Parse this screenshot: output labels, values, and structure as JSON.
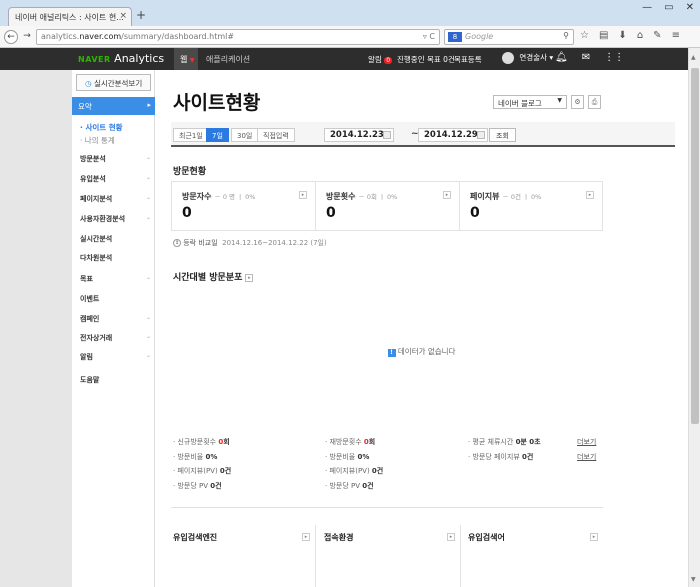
{
  "browser": {
    "tab_title": "네이버 애널리틱스 : 사이트 현...",
    "tab_close": "×",
    "new_tab": "+",
    "url_prefix": "analytics.",
    "url_domain": "naver.com",
    "url_path": "/summary/dashboard.html#",
    "search_engine": "8",
    "search_placeholder": "Google"
  },
  "topbar": {
    "logo_naver": "NAVER",
    "logo_analytics": "Analytics",
    "menu_web": "웹",
    "menu_app": "애플리케이션",
    "alarm_label": "알림",
    "alarm_count": "0",
    "progress_goal": "진행중인 목표 0건",
    "goal_register": "목표등록",
    "user_name": "연경술사 ▾"
  },
  "sidebar": {
    "realtime_button": "실시간분석보기",
    "active_item": "요약",
    "sub_items": [
      "· 사이트 현황",
      "· 나의 통계"
    ],
    "items": [
      {
        "label": "방문분석",
        "chev": true
      },
      {
        "label": "유입분석",
        "chev": true
      },
      {
        "label": "페이지분석",
        "chev": true
      },
      {
        "label": "사용자환경분석",
        "chev": true
      },
      {
        "label": "실시간분석",
        "chev": false
      },
      {
        "label": "다차원분석",
        "chev": false
      },
      {
        "label": "목표",
        "chev": true
      },
      {
        "label": "이벤트",
        "chev": false
      },
      {
        "label": "캠페인",
        "chev": true
      },
      {
        "label": "전자상거래",
        "chev": true
      },
      {
        "label": "알림",
        "chev": true
      },
      {
        "label": "도움말",
        "chev": false
      }
    ]
  },
  "main": {
    "page_title": "사이트현황",
    "site_select": "네이버 블로그",
    "range_buttons": [
      "최근1일",
      "7일",
      "30일",
      "직접입력"
    ],
    "selected_range": "7일",
    "date_start": "2014.12.23",
    "date_tilde": "~",
    "date_end": "2014.12.29",
    "search_button": "조회",
    "visit_section_title": "방문현황",
    "stats": [
      {
        "label": "방문자수",
        "sub": "－ 0 명 ㅣ 0%",
        "value": "0"
      },
      {
        "label": "방문횟수",
        "sub": "－ 0회 ㅣ 0%",
        "value": "0"
      },
      {
        "label": "페이지뷰",
        "sub": "－ 0건 ㅣ 0%",
        "value": "0"
      }
    ],
    "compare_label": "등락 비교일",
    "compare_range": "2014.12.16~2014.12.22 (7일)",
    "time_section_title": "시간대별 방문분포",
    "no_data": "데이터가 없습니다",
    "metrics_col1": [
      {
        "label": "· 신규방문횟수",
        "value": "0",
        "unit": "회",
        "red": true
      },
      {
        "label": "· 방문비율",
        "value": "0",
        "unit": "%",
        "red": false
      },
      {
        "label": "· 페이지뷰(PV)",
        "value": "0",
        "unit": "건",
        "red": false
      },
      {
        "label": "· 방문당 PV",
        "value": "0",
        "unit": "건",
        "red": false
      }
    ],
    "metrics_col2": [
      {
        "label": "· 재방문횟수",
        "value": "0",
        "unit": "회",
        "red": true
      },
      {
        "label": "· 방문비율",
        "value": "0",
        "unit": "%",
        "red": false
      },
      {
        "label": "· 페이지뷰(PV)",
        "value": "0",
        "unit": "건",
        "red": false
      },
      {
        "label": "· 방문당 PV",
        "value": "0",
        "unit": "건",
        "red": false
      }
    ],
    "metrics_col3": [
      {
        "label": "· 평균 체류시간",
        "value": "0분 0초",
        "more": "더보기"
      },
      {
        "label": "· 방문당 페이지뷰",
        "value": "0건",
        "more": "더보기"
      }
    ],
    "bottom_sections": [
      "유입검색엔진",
      "접속환경",
      "유입검색어"
    ]
  },
  "colors": {
    "accent_blue": "#3a8ee6",
    "naver_green": "#2db400",
    "topbar_bg": "#2d2d2d",
    "alert_red": "#e22222"
  }
}
